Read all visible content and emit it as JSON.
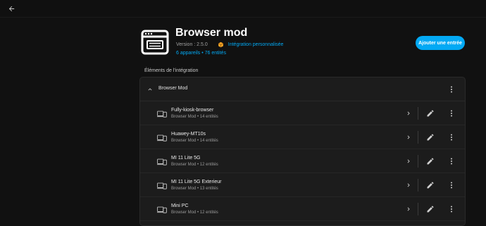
{
  "header": {
    "title": "Browser mod",
    "version": "Version : 2.5.0",
    "custom_integration": "Intégration personnalisée",
    "devices_link": "6 appareils",
    "dot": " • ",
    "entities_link": "76 entités",
    "add_button": "Ajouter une entrée"
  },
  "section": {
    "title": "Éléments de l'intégration"
  },
  "group": {
    "label": "Browser Mod"
  },
  "rows": [
    {
      "name": "Fully-kiosk-browser",
      "sub": "Browser Mod • 14 entités"
    },
    {
      "name": "Huawey-MT10s",
      "sub": "Browser Mod • 14 entités"
    },
    {
      "name": "MI 11 Lite 5G",
      "sub": "Browser Mod • 12 entités"
    },
    {
      "name": "MI 11 Lite 5G Exterieur",
      "sub": "Browser Mod • 13 entités"
    },
    {
      "name": "Mini PC",
      "sub": "Browser Mod • 12 entités"
    }
  ],
  "colors": {
    "accent": "#03a9f4",
    "background": "#111111",
    "card": "#1c1c1c",
    "badge": "#ffa726"
  },
  "icons": {
    "back": "arrow-left-icon",
    "logo": "browser-window-icon",
    "custom": "package-icon",
    "chevron_up": "chevron-up-icon",
    "device": "devices-icon",
    "chevron_right": "chevron-right-icon",
    "edit": "pencil-icon",
    "menu": "dots-vertical-icon"
  }
}
